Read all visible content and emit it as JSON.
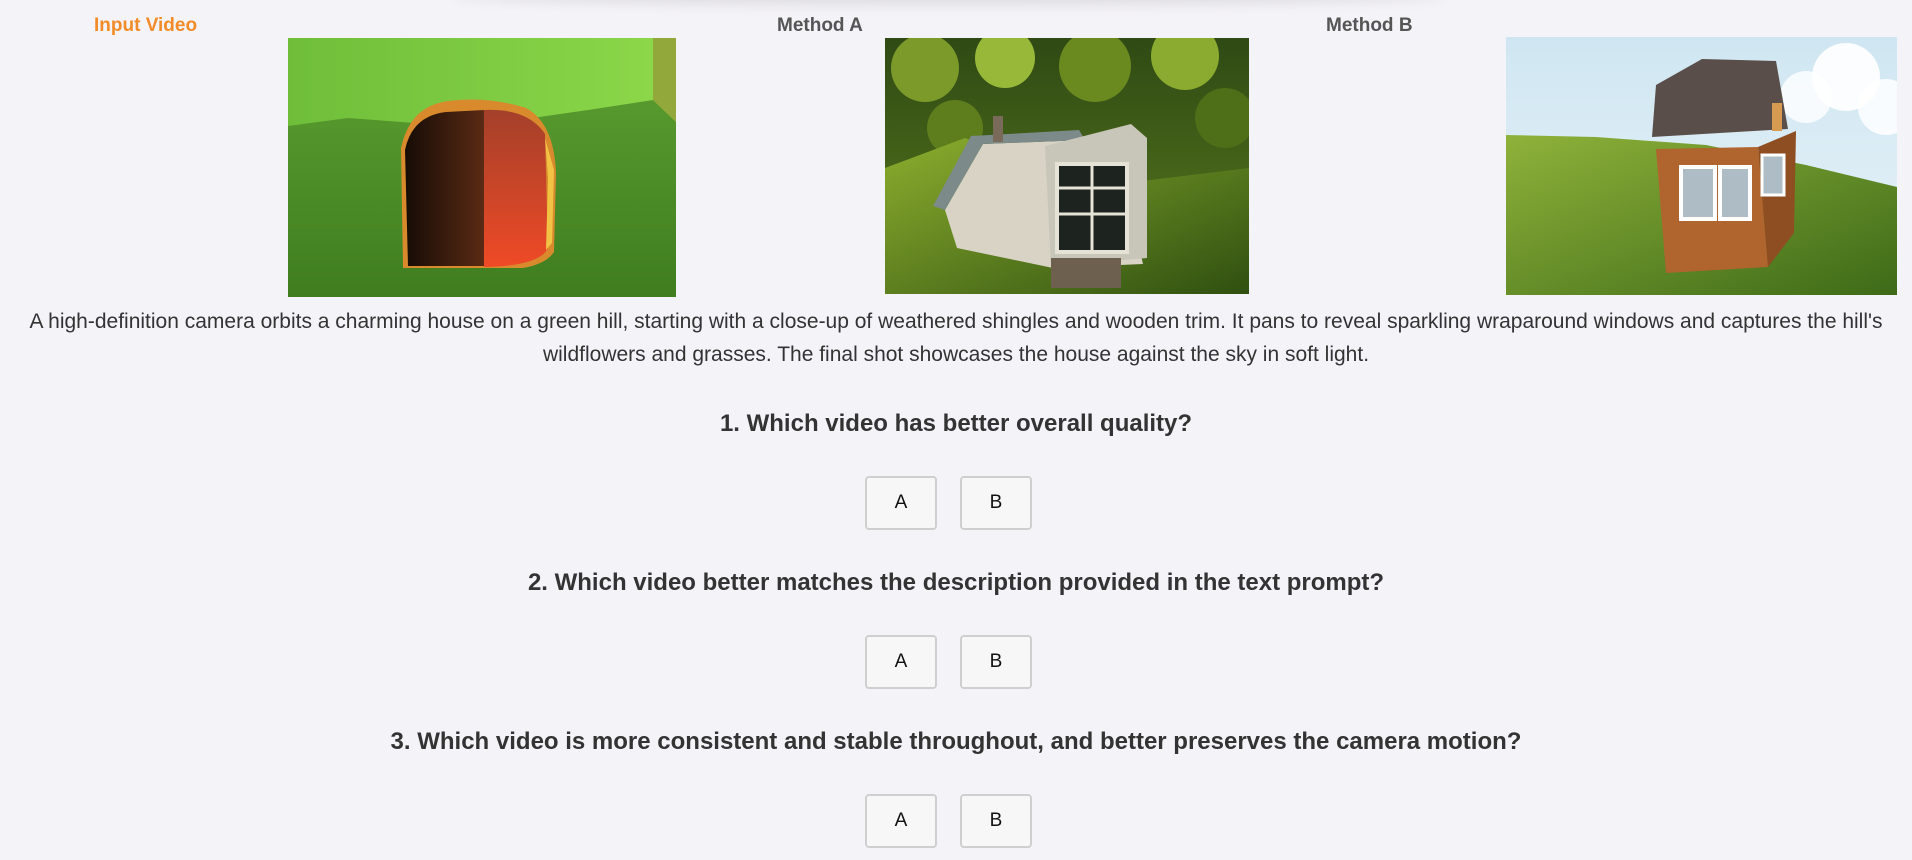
{
  "columns": {
    "input_label": "Input Video",
    "method_a_label": "Method A",
    "method_b_label": "Method B"
  },
  "prompt": "A high-definition camera orbits a charming house on a green hill, starting with a close-up of weathered shingles and wooden trim. It pans to reveal sparkling wraparound windows and captures the hill's wildflowers and grasses. The final shot showcases the house against the sky in soft light.",
  "questions": [
    {
      "text": "1. Which video has better overall quality?",
      "option_a": "A",
      "option_b": "B"
    },
    {
      "text": "2. Which video better matches the description provided in the text prompt?",
      "option_a": "A",
      "option_b": "B"
    },
    {
      "text": "3. Which video is more consistent and stable throughout, and better preserves the camera motion?",
      "option_a": "A",
      "option_b": "B"
    }
  ],
  "colors": {
    "accent": "#f28c28",
    "page_background": "#f4f3f8",
    "heading_text": "#333333",
    "muted_label": "#555555"
  }
}
